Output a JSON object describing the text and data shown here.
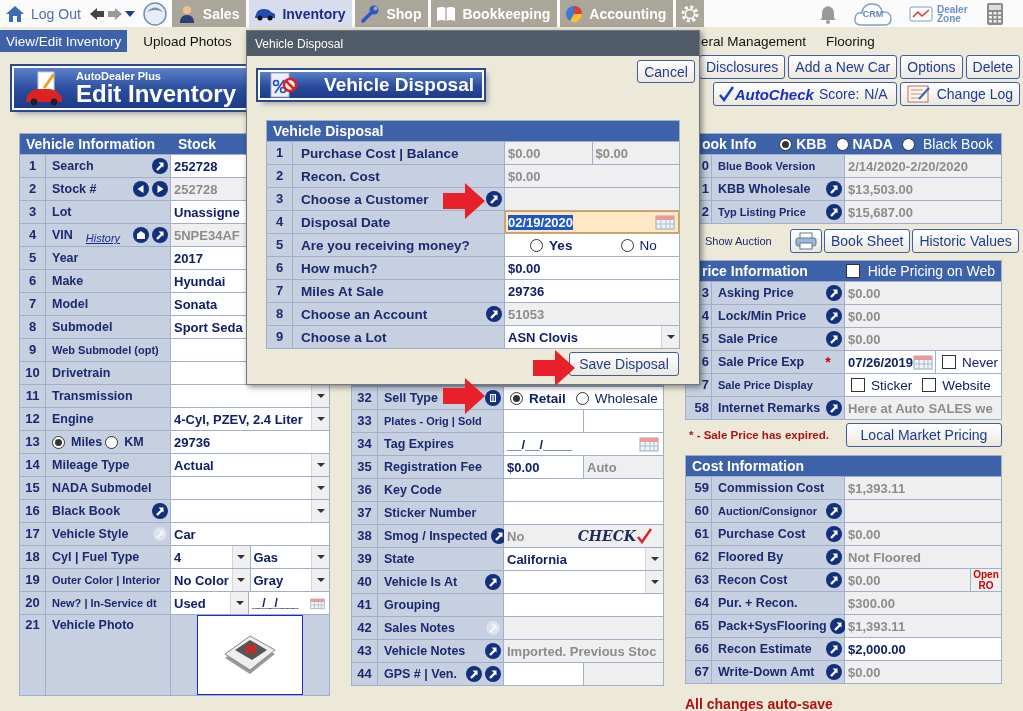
{
  "topbar": {
    "logout": "Log Out",
    "tabs": [
      {
        "label": "Sales",
        "selected": false
      },
      {
        "label": "Inventory",
        "selected": true
      },
      {
        "label": "Shop",
        "selected": false
      },
      {
        "label": "Bookkeeping",
        "selected": false
      },
      {
        "label": "Accounting",
        "selected": false
      }
    ],
    "crm": "CRM",
    "dealer_zone": "Dealer Zone"
  },
  "subnav": {
    "left": [
      {
        "label": "View/Edit Inventory",
        "selected": true
      },
      {
        "label": "Upload Photos",
        "selected": false
      }
    ],
    "right": [
      {
        "label": "eral Management",
        "selected": false
      },
      {
        "label": "Flooring",
        "selected": false
      }
    ]
  },
  "header": {
    "brand": "AutoDealer Plus",
    "title": "Edit Inventory",
    "actions": [
      "Disclosures",
      "Add a New Car",
      "Options",
      "Delete"
    ],
    "autocheck": {
      "label": "AutoCheck",
      "score_label": "Score:",
      "score": "N/A"
    },
    "change_log": "Change Log"
  },
  "vehicle_info": {
    "title": "Vehicle Information",
    "value_heading": "Stock",
    "rows": [
      {
        "num": "1",
        "label": "Search",
        "icons": [
          {
            "kind": "go"
          }
        ],
        "cells": [
          {
            "kind": "input",
            "value": "252728"
          }
        ]
      },
      {
        "num": "2",
        "label": "Stock #",
        "icons": [
          {
            "kind": "prev"
          },
          {
            "kind": "next"
          }
        ],
        "cells": [
          {
            "kind": "readonly",
            "value": "252728"
          }
        ]
      },
      {
        "num": "3",
        "label": "Lot",
        "cells": [
          {
            "kind": "input",
            "value": "Unassigne"
          }
        ]
      },
      {
        "num": "4",
        "label": "VIN",
        "link": "History",
        "icons": [
          {
            "kind": "tag"
          },
          {
            "kind": "go"
          }
        ],
        "cells": [
          {
            "kind": "readonly",
            "value": "5NPE34AF"
          }
        ]
      },
      {
        "num": "5",
        "label": "Year",
        "cells": [
          {
            "kind": "input",
            "value": "2017"
          }
        ]
      },
      {
        "num": "6",
        "label": "Make",
        "cells": [
          {
            "kind": "input",
            "value": "Hyundai"
          }
        ]
      },
      {
        "num": "7",
        "label": "Model",
        "cells": [
          {
            "kind": "input",
            "value": "Sonata"
          }
        ]
      },
      {
        "num": "8",
        "label": "Submodel",
        "cells": [
          {
            "kind": "input",
            "value": "Sport Seda"
          }
        ]
      },
      {
        "num": "9",
        "label": "Web Submodel (opt)",
        "cells": [
          {
            "kind": "input"
          }
        ]
      },
      {
        "num": "10",
        "label": "Drivetrain",
        "cells": [
          {
            "kind": "input"
          }
        ]
      },
      {
        "num": "11",
        "label": "Transmission",
        "cells": [
          {
            "kind": "select"
          }
        ]
      },
      {
        "num": "12",
        "label": "Engine",
        "cells": [
          {
            "kind": "select",
            "value": "4-Cyl, PZEV, 2.4 Liter"
          }
        ]
      },
      {
        "num": "13",
        "label_options": [
          {
            "label": "Miles",
            "selected": true
          },
          {
            "label": "KM",
            "selected": false
          }
        ],
        "cells": [
          {
            "kind": "input",
            "value": "29736"
          }
        ]
      },
      {
        "num": "14",
        "label": "Mileage Type",
        "cells": [
          {
            "kind": "select",
            "value": "Actual"
          }
        ]
      },
      {
        "num": "15",
        "label": "NADA Submodel",
        "cells": [
          {
            "kind": "select"
          }
        ]
      },
      {
        "num": "16",
        "label": "Black Book",
        "icons": [
          {
            "kind": "go"
          }
        ],
        "cells": [
          {
            "kind": "select"
          }
        ]
      },
      {
        "num": "17",
        "label": "Vehicle Style",
        "icons": [
          {
            "kind": "go-off"
          }
        ],
        "cells": [
          {
            "kind": "input",
            "value": "Car"
          }
        ]
      },
      {
        "num": "18",
        "label": "Cyl | Fuel Type",
        "cells": [
          {
            "kind": "select",
            "value": "4"
          },
          {
            "kind": "select",
            "value": "Gas"
          }
        ]
      },
      {
        "num": "19",
        "label": "Outer Color | Interior",
        "cells": [
          {
            "kind": "select",
            "value": "No Color"
          },
          {
            "kind": "select",
            "value": "Gray"
          }
        ]
      },
      {
        "num": "20",
        "label": "New? | In-Service dt",
        "cells": [
          {
            "kind": "select",
            "value": "Used"
          },
          {
            "kind": "date",
            "value": "__/__/____"
          }
        ]
      },
      {
        "num": "21",
        "label": "Vehicle Photo",
        "cells": [
          {
            "kind": "photo"
          }
        ]
      }
    ]
  },
  "details": {
    "rows": [
      {
        "num": "32",
        "label": "Sell Type",
        "icons": [
          {
            "kind": "trash"
          }
        ],
        "cells": [
          {
            "kind": "radios",
            "options": [
              {
                "label": "Retail",
                "selected": true
              },
              {
                "label": "Wholesale",
                "selected": false
              }
            ]
          }
        ]
      },
      {
        "num": "33",
        "label": "Plates - Orig | Sold",
        "cells": [
          {
            "kind": "input"
          },
          {
            "kind": "input"
          }
        ]
      },
      {
        "num": "34",
        "label": "Tag Expires",
        "cells": [
          {
            "kind": "date",
            "value": "__/__/____"
          }
        ]
      },
      {
        "num": "35",
        "label": "Registration Fee",
        "cells": [
          {
            "kind": "input",
            "value": "$0.00"
          },
          {
            "kind": "readonly",
            "value": "Auto"
          }
        ]
      },
      {
        "num": "36",
        "label": "Key Code",
        "cells": [
          {
            "kind": "input"
          }
        ]
      },
      {
        "num": "37",
        "label": "Sticker Number",
        "cells": [
          {
            "kind": "input"
          }
        ]
      },
      {
        "num": "38",
        "label": "Smog / Inspected",
        "icons": [
          {
            "kind": "go"
          }
        ],
        "cells": [
          {
            "kind": "readonly",
            "value": "No",
            "logo": "CHECK"
          }
        ]
      },
      {
        "num": "39",
        "label": "State",
        "cells": [
          {
            "kind": "select",
            "value": "California"
          }
        ]
      },
      {
        "num": "40",
        "label": "Vehicle Is At",
        "icons": [
          {
            "kind": "go"
          }
        ],
        "cells": [
          {
            "kind": "select"
          }
        ]
      },
      {
        "num": "41",
        "label": "Grouping",
        "cells": [
          {
            "kind": "input"
          }
        ]
      },
      {
        "num": "42",
        "label": "Sales Notes",
        "icons": [
          {
            "kind": "go-off"
          }
        ],
        "cells": [
          {
            "kind": "readonly"
          }
        ]
      },
      {
        "num": "43",
        "label": "Vehicle Notes",
        "icons": [
          {
            "kind": "go"
          }
        ],
        "cells": [
          {
            "kind": "readonly",
            "value": "Imported.  Previous Stoc"
          }
        ]
      },
      {
        "num": "44",
        "label": "GPS # | Ven.",
        "icons": [
          {
            "kind": "go"
          },
          {
            "kind": "go"
          }
        ],
        "cells": [
          {
            "kind": "input"
          },
          {
            "kind": "readonly"
          }
        ]
      }
    ]
  },
  "book_info": {
    "title": "ook Info",
    "options": [
      {
        "label": "KBB",
        "selected": true
      },
      {
        "label": "NADA",
        "selected": false
      },
      {
        "label": "Black Book",
        "selected": false
      }
    ],
    "rows": [
      {
        "num": "0",
        "label": "Blue Book Version",
        "cells": [
          {
            "kind": "readonly",
            "value": "2/14/2020-2/20/2020"
          }
        ]
      },
      {
        "num": "1",
        "label": "KBB Wholesale",
        "icons": [
          {
            "kind": "go"
          }
        ],
        "cells": [
          {
            "kind": "readonly",
            "value": "$13,503.00"
          }
        ]
      },
      {
        "num": "2",
        "label": "Typ Listing Price",
        "icons": [
          {
            "kind": "go"
          }
        ],
        "cells": [
          {
            "kind": "readonly",
            "value": "$15,687.00"
          }
        ]
      }
    ],
    "show_auction": "Show Auction",
    "buttons": [
      "Book Sheet",
      "Historic Values"
    ]
  },
  "price_info": {
    "title": "rice Information",
    "hide_pricing": {
      "label": "Hide Pricing on Web",
      "checked": false
    },
    "rows": [
      {
        "num": "3",
        "label": "Asking Price",
        "icons": [
          {
            "kind": "go"
          }
        ],
        "cells": [
          {
            "kind": "readonly",
            "value": "$0.00"
          }
        ]
      },
      {
        "num": "4",
        "label": "Lock/Min Price",
        "icons": [
          {
            "kind": "go"
          }
        ],
        "cells": [
          {
            "kind": "readonly",
            "value": "$0.00"
          }
        ]
      },
      {
        "num": "5",
        "label": "Sale Price",
        "icons": [
          {
            "kind": "go"
          }
        ],
        "cells": [
          {
            "kind": "readonly",
            "value": "$0.00"
          }
        ]
      },
      {
        "num": "6",
        "label": "Sale Price Exp",
        "mark": "*",
        "cells": [
          {
            "kind": "date",
            "value": "07/26/2019"
          },
          {
            "kind": "check",
            "label": "Never",
            "checked": false
          }
        ]
      },
      {
        "num": "7",
        "label": "Sale Price Display",
        "cells": [
          {
            "kind": "checks",
            "options": [
              {
                "label": "Sticker",
                "checked": false
              },
              {
                "label": "Website",
                "checked": false
              }
            ]
          }
        ]
      },
      {
        "num": "58",
        "label": "Internet Remarks",
        "icons": [
          {
            "kind": "go"
          }
        ],
        "cells": [
          {
            "kind": "readonly",
            "value": "Here at Auto SALES we"
          }
        ]
      }
    ],
    "note": "* - Sale Price has expired.",
    "button": "Local Market Pricing"
  },
  "cost_info": {
    "title": "Cost Information",
    "rows": [
      {
        "num": "59",
        "label": "Commission Cost",
        "cells": [
          {
            "kind": "readonly",
            "value": "$1,393.11"
          }
        ]
      },
      {
        "num": "60",
        "label": "Auction/Consignor",
        "icons": [
          {
            "kind": "go"
          }
        ],
        "cells": [
          {
            "kind": "readonly"
          }
        ]
      },
      {
        "num": "61",
        "label": "Purchase Cost",
        "icons": [
          {
            "kind": "go"
          }
        ],
        "cells": [
          {
            "kind": "readonly",
            "value": "$0.00"
          }
        ]
      },
      {
        "num": "62",
        "label": "Floored By",
        "icons": [
          {
            "kind": "go"
          }
        ],
        "cells": [
          {
            "kind": "readonly",
            "value": "Not Floored"
          }
        ]
      },
      {
        "num": "63",
        "label": "Recon Cost",
        "icons": [
          {
            "kind": "go"
          }
        ],
        "cells": [
          {
            "kind": "readonly",
            "value": "$0.00"
          },
          {
            "kind": "flag",
            "value": "Open RO"
          }
        ]
      },
      {
        "num": "64",
        "label": "Pur. + Recon.",
        "cells": [
          {
            "kind": "readonly",
            "value": "$300.00"
          }
        ]
      },
      {
        "num": "65",
        "label": "Pack+SysFlooring",
        "icons": [
          {
            "kind": "go"
          }
        ],
        "cells": [
          {
            "kind": "readonly",
            "value": "$1,393.11"
          }
        ]
      },
      {
        "num": "66",
        "label": "Recon Estimate",
        "icons": [
          {
            "kind": "go"
          }
        ],
        "cells": [
          {
            "kind": "input",
            "value": "$2,000.00"
          }
        ]
      },
      {
        "num": "67",
        "label": "Write-Down Amt",
        "icons": [
          {
            "kind": "go"
          }
        ],
        "cells": [
          {
            "kind": "readonly",
            "value": "$0.00"
          }
        ]
      }
    ]
  },
  "autosave": "All changes auto-save",
  "dialog": {
    "title": "Vehicle Disposal",
    "heading": "Vehicle Disposal",
    "cancel": "Cancel",
    "table_title": "Vehicle Disposal",
    "rows": [
      {
        "num": "1",
        "label": "Purchase Cost | Balance",
        "cells": [
          {
            "kind": "readonly",
            "value": "$0.00"
          },
          {
            "kind": "readonly",
            "value": "$0.00"
          }
        ]
      },
      {
        "num": "2",
        "label": "Recon. Cost",
        "cells": [
          {
            "kind": "readonly",
            "value": "$0.00"
          }
        ]
      },
      {
        "num": "3",
        "label": "Choose a Customer",
        "icons": [
          {
            "kind": "go"
          }
        ],
        "cells": [
          {
            "kind": "readonly"
          }
        ]
      },
      {
        "num": "4",
        "label": "Disposal Date",
        "cells": [
          {
            "kind": "date",
            "value": "02/19/2020",
            "focused": true
          }
        ]
      },
      {
        "num": "5",
        "label": "Are you receiving money?",
        "cells": [
          {
            "kind": "radios",
            "options": [
              {
                "label": "Yes",
                "selected": false
              },
              {
                "label": "No",
                "selected": false
              }
            ]
          }
        ]
      },
      {
        "num": "6",
        "label": "How much?",
        "cells": [
          {
            "kind": "input",
            "value": "$0.00"
          }
        ]
      },
      {
        "num": "7",
        "label": "Miles At Sale",
        "cells": [
          {
            "kind": "input",
            "value": "29736"
          }
        ]
      },
      {
        "num": "8",
        "label": "Choose an Account",
        "icons": [
          {
            "kind": "go"
          }
        ],
        "cells": [
          {
            "kind": "readonly",
            "value": "51053"
          }
        ]
      },
      {
        "num": "9",
        "label": "Choose a Lot",
        "cells": [
          {
            "kind": "select",
            "value": "ASN Clovis"
          }
        ]
      }
    ],
    "save": "Save Disposal"
  }
}
